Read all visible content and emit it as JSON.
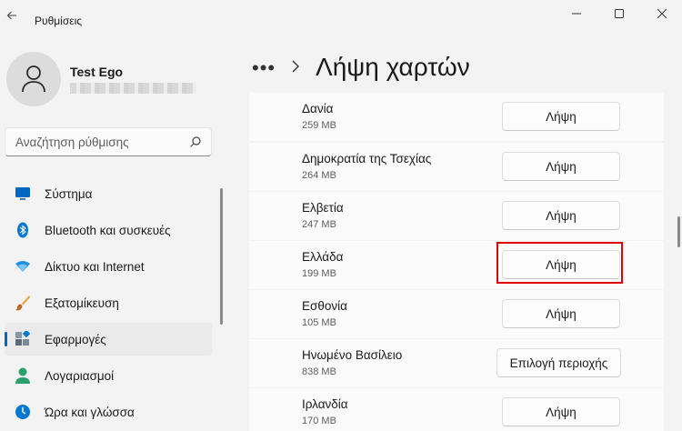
{
  "window": {
    "app_title": "Ρυθμίσεις",
    "controls": [
      "minimize",
      "maximize",
      "close"
    ]
  },
  "profile": {
    "name": "Test Ego",
    "email_redacted": true
  },
  "search": {
    "placeholder": "Αναζήτηση ρύθμισης",
    "icon": "search-icon"
  },
  "nav": {
    "items": [
      {
        "label": "Σύστημα",
        "icon": "system-icon",
        "color": "#0067c0",
        "selected": false
      },
      {
        "label": "Bluetooth και συσκευές",
        "icon": "bluetooth-icon",
        "color": "#0078d4",
        "selected": false
      },
      {
        "label": "Δίκτυο και Internet",
        "icon": "network-icon",
        "color": "#1a8fe3",
        "selected": false
      },
      {
        "label": "Εξατομίκευση",
        "icon": "personalization-icon",
        "color": "#e9a03b",
        "selected": false
      },
      {
        "label": "Εφαρμογές",
        "icon": "apps-icon",
        "color": "#5c6c7c",
        "selected": true
      },
      {
        "label": "Λογαριασμοί",
        "icon": "accounts-icon",
        "color": "#2aa16c",
        "selected": false
      },
      {
        "label": "Ώρα και γλώσσα",
        "icon": "time-language-icon",
        "color": "#0078d4",
        "selected": false
      }
    ]
  },
  "header": {
    "breadcrumb_more": "•••",
    "page_title": "Λήψη χαρτών"
  },
  "maps": [
    {
      "name": "Δανία",
      "size": "259 MB",
      "button": "Λήψη"
    },
    {
      "name": "Δημοκρατία της Τσεχίας",
      "size": "264 MB",
      "button": "Λήψη"
    },
    {
      "name": "Ελβετία",
      "size": "247 MB",
      "button": "Λήψη"
    },
    {
      "name": "Ελλάδα",
      "size": "199 MB",
      "button": "Λήψη",
      "highlighted": true
    },
    {
      "name": "Εσθονία",
      "size": "105 MB",
      "button": "Λήψη"
    },
    {
      "name": "Ηνωμένο Βασίλειο",
      "size": "838 MB",
      "button": "Επιλογή περιοχής"
    },
    {
      "name": "Ιρλανδία",
      "size": "170 MB",
      "button": "Λήψη"
    }
  ],
  "colors": {
    "accent": "#0067c0",
    "highlight_box": "#e00000"
  }
}
